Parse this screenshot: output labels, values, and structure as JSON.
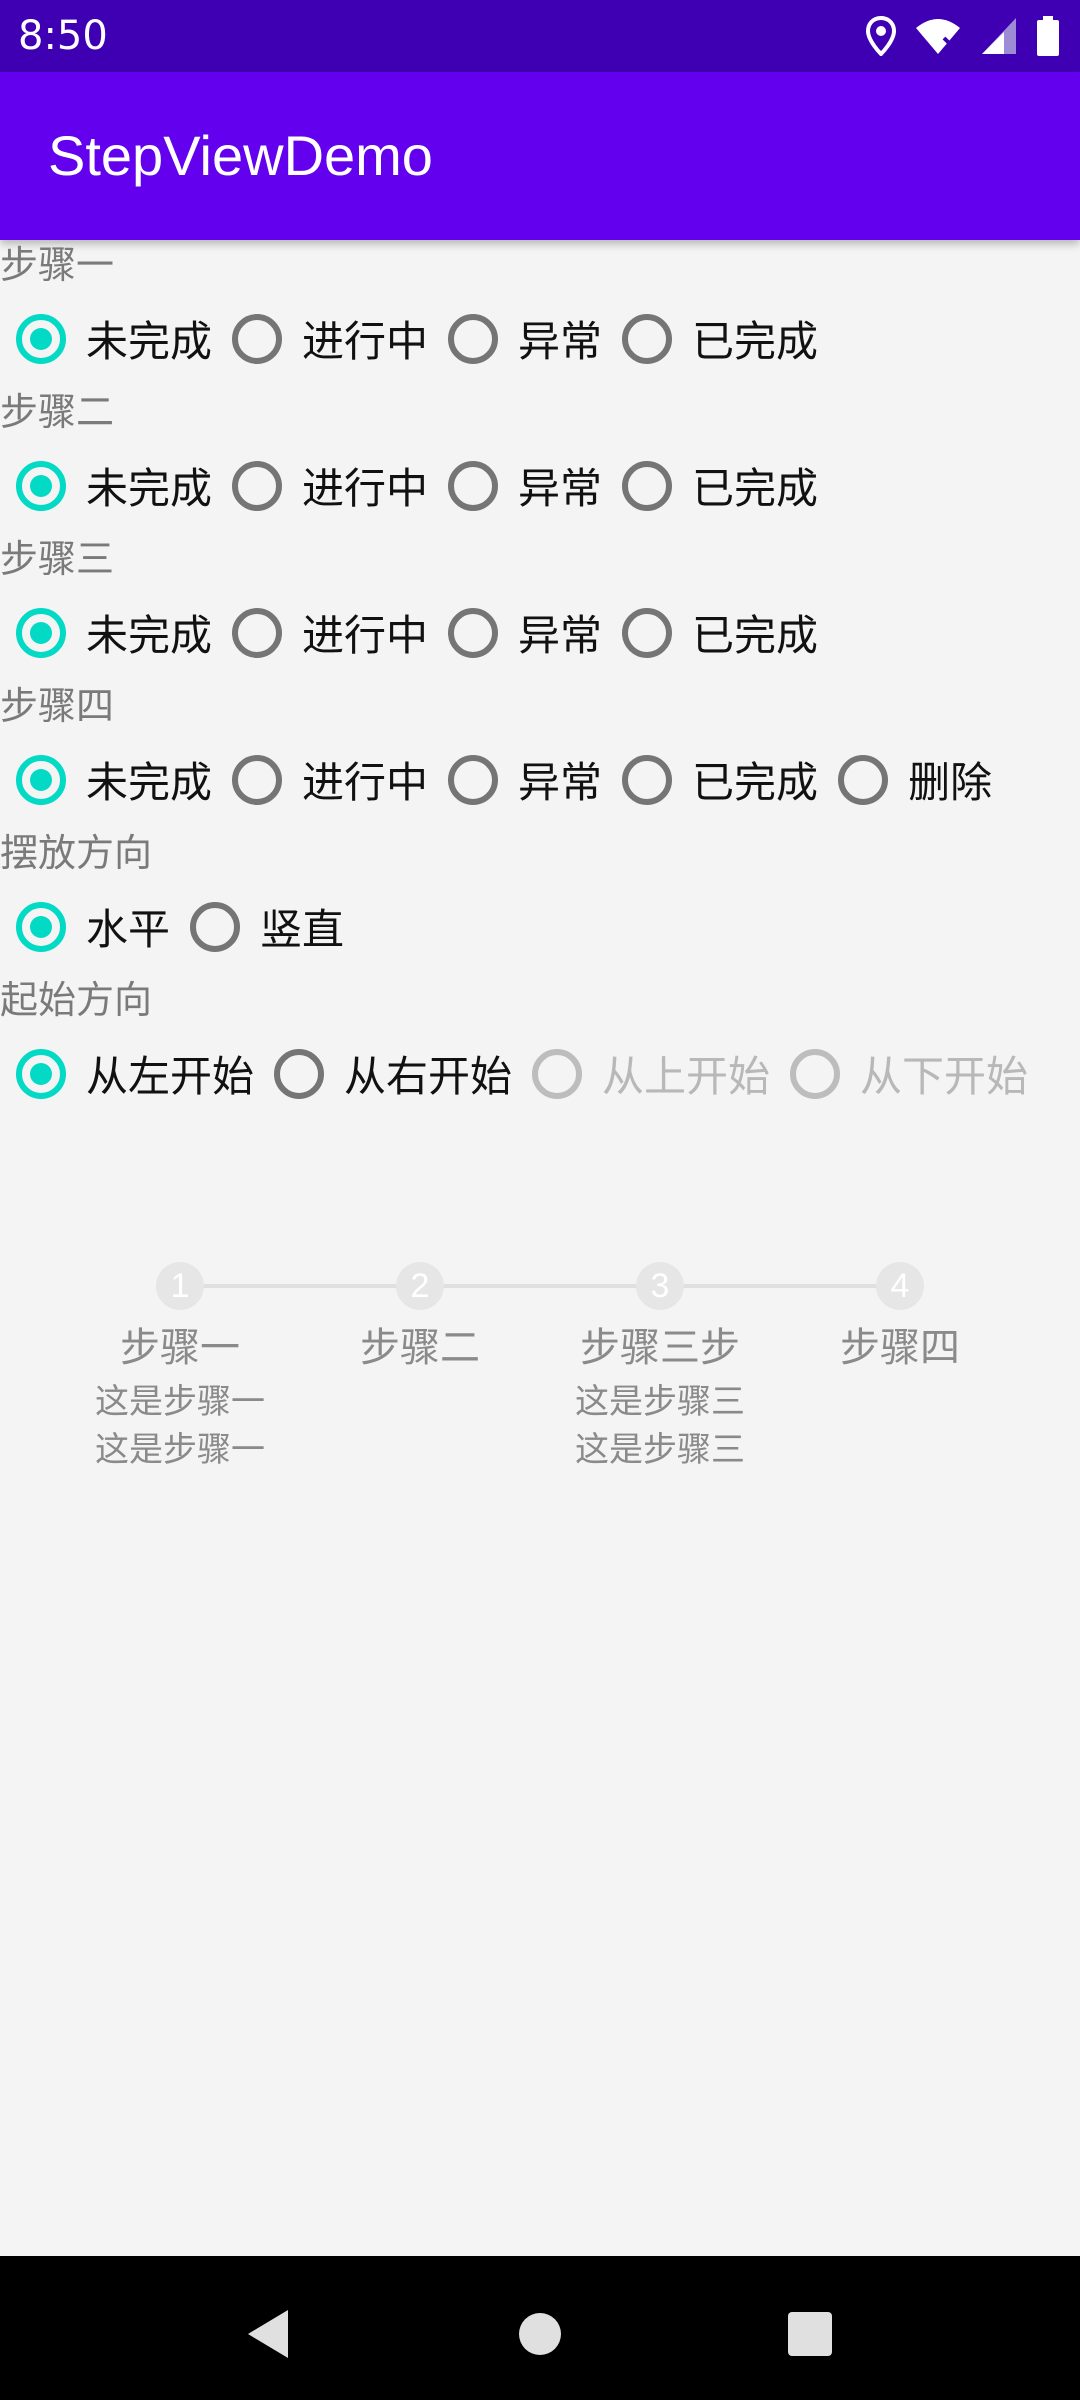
{
  "status": {
    "time": "8:50"
  },
  "appbar": {
    "title": "StepViewDemo"
  },
  "sections": [
    {
      "label": "步骤一",
      "options": [
        "未完成",
        "进行中",
        "异常",
        "已完成"
      ],
      "selected": 0
    },
    {
      "label": "步骤二",
      "options": [
        "未完成",
        "进行中",
        "异常",
        "已完成"
      ],
      "selected": 0
    },
    {
      "label": "步骤三",
      "options": [
        "未完成",
        "进行中",
        "异常",
        "已完成"
      ],
      "selected": 0
    },
    {
      "label": "步骤四",
      "options": [
        "未完成",
        "进行中",
        "异常",
        "已完成",
        "删除"
      ],
      "selected": 0
    },
    {
      "label": "摆放方向",
      "options": [
        "水平",
        "竖直"
      ],
      "selected": 0
    },
    {
      "label": "起始方向",
      "options": [
        "从左开始",
        "从右开始",
        "从上开始",
        "从下开始"
      ],
      "selected": 0,
      "disabled": [
        2,
        3
      ]
    }
  ],
  "stepview": {
    "steps": [
      {
        "number": "1",
        "title": "步骤一",
        "desc1": "这是步骤一",
        "desc2": "这是步骤一"
      },
      {
        "number": "2",
        "title": "步骤二",
        "desc1": "",
        "desc2": ""
      },
      {
        "number": "3",
        "title": "步骤三步",
        "desc1": "这是步骤三",
        "desc2": "这是步骤三"
      },
      {
        "number": "4",
        "title": "步骤四",
        "desc1": "",
        "desc2": ""
      }
    ]
  },
  "colors": {
    "accent": "#03dac5",
    "primary": "#6300ee",
    "statusbar": "#3f00b4"
  },
  "icons": {
    "location": "location-icon",
    "wifi": "wifi-icon",
    "signal": "signal-icon",
    "battery": "battery-icon"
  }
}
